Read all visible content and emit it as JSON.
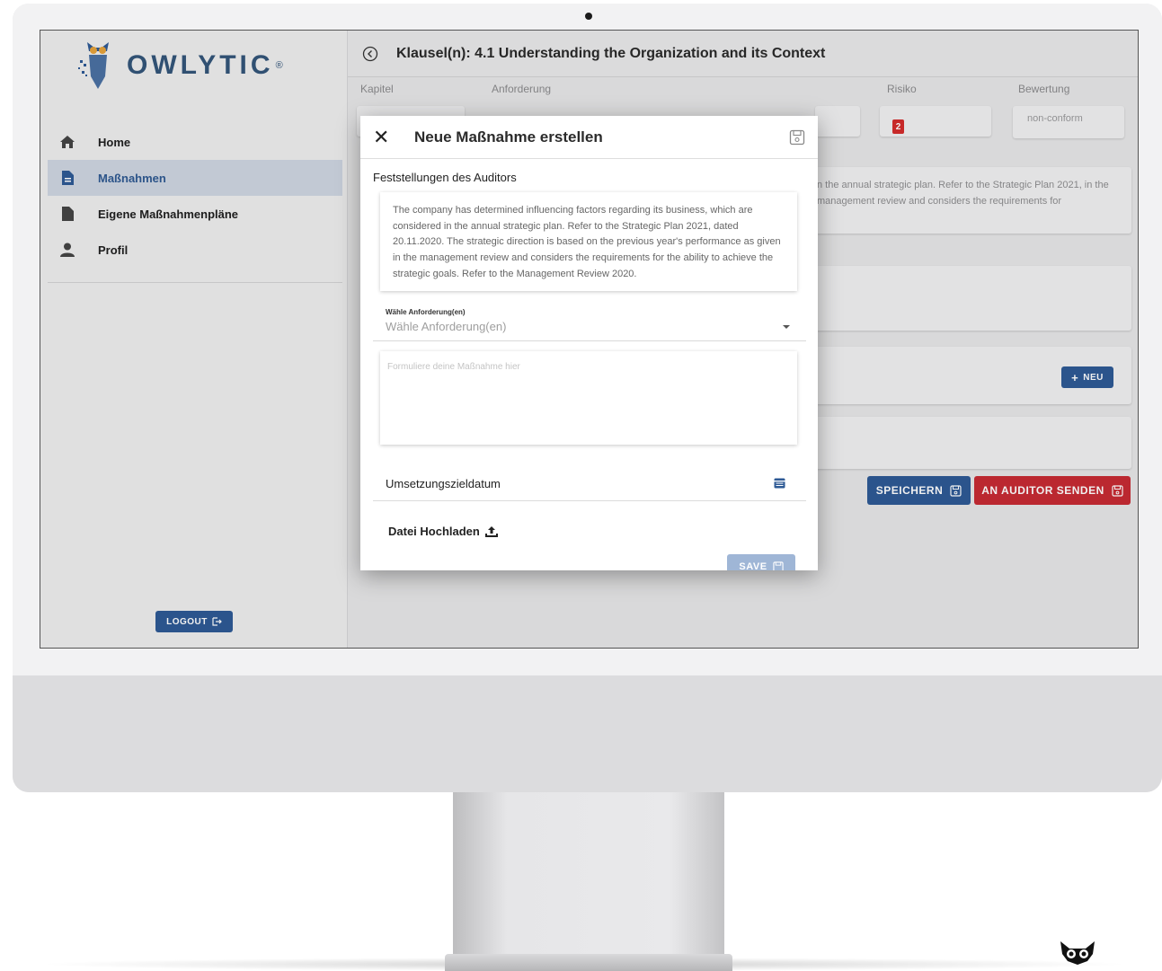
{
  "brand": {
    "name": "OWLYTIC",
    "mark": "®"
  },
  "sidebar": {
    "items": [
      {
        "label": "Home",
        "icon": "home-icon"
      },
      {
        "label": "Maßnahmen",
        "icon": "file-icon",
        "active": true
      },
      {
        "label": "Eigene Maßnahmenpläne",
        "icon": "file-icon"
      },
      {
        "label": "Profil",
        "icon": "user-icon"
      }
    ],
    "logout_label": "LOGOUT"
  },
  "header": {
    "title": "Klausel(n): 4.1 Understanding the Organization and its Context"
  },
  "columns": {
    "kapitel": "Kapitel",
    "anforderung": "Anforderung",
    "risiko": "Risiko",
    "bewertung": "Bewertung"
  },
  "risk_value": "2",
  "rating_value": "non-conform",
  "background_text": "n the annual strategic plan. Refer to the Strategic Plan 2021, in the management review and considers the requirements for",
  "buttons": {
    "neu": "NEU",
    "speichern": "SPEICHERN",
    "an_auditor": "AN AUDITOR SENDEN"
  },
  "modal": {
    "title": "Neue Maßnahme erstellen",
    "findings_title": "Feststellungen des Auditors",
    "findings_text": "The company has determined influencing factors regarding its business, which are considered in the annual strategic plan. Refer to the Strategic Plan 2021, dated 20.11.2020. The strategic direction is based on the previous year's performance as given in the management review and considers the requirements for the ability to achieve the strategic goals. Refer to the Management Review 2020.",
    "select_label": "Wähle Anforderung(en)",
    "select_placeholder": "Wähle Anforderung(en)",
    "textarea_placeholder": "Formuliere deine Maßnahme hier",
    "date_label": "Umsetzungszieldatum",
    "upload_label": "Datei Hochladen",
    "save_label": "SAVE"
  },
  "colors": {
    "primary": "#2e5a95",
    "danger": "#c72b33",
    "active_bg": "#cfd6e2"
  }
}
